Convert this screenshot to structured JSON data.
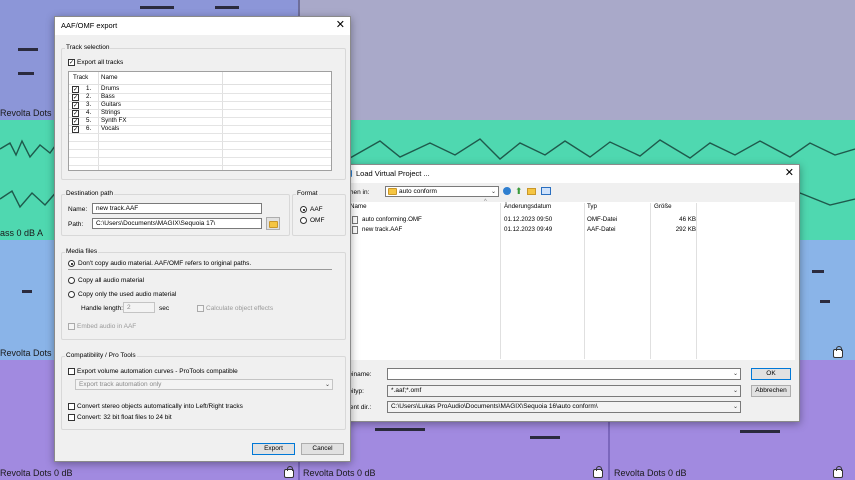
{
  "background": {
    "labels_left": [
      "Revolta Dots",
      "ass  0 dB  A",
      "Revolta Dots",
      "Revolta Dots  0 dB"
    ],
    "labels_bottom": [
      "Revolta Dots  0 dB",
      "Revolta Dots  0 dB"
    ]
  },
  "export_dialog": {
    "title": "AAF/OMF export",
    "track_selection": {
      "group_title": "Track selection",
      "export_all_label": "Export all tracks",
      "columns": [
        "Track",
        "Name"
      ],
      "tracks": [
        {
          "num": "1.",
          "name": "Drums"
        },
        {
          "num": "2.",
          "name": "Bass"
        },
        {
          "num": "3.",
          "name": "Guitars"
        },
        {
          "num": "4.",
          "name": "Strings"
        },
        {
          "num": "5.",
          "name": "Synth FX"
        },
        {
          "num": "6.",
          "name": "Vocals"
        }
      ]
    },
    "destination": {
      "group_title": "Destination path",
      "name_label": "Name:",
      "name_value": "new track.AAF",
      "path_label": "Path:",
      "path_value": "C:\\Users\\Documents\\MAGIX\\Sequoia 17\\"
    },
    "format": {
      "group_title": "Format",
      "options": [
        "AAF",
        "OMF"
      ]
    },
    "media_files": {
      "group_title": "Media files",
      "opt_dont_copy": "Don't copy audio material. AAF/OMF refers to original paths.",
      "opt_copy_all": "Copy all audio material",
      "opt_copy_used": "Copy only the used audio material",
      "handle_label": "Handle length:",
      "handle_value": "2",
      "handle_unit": "sec",
      "calc_effects": "Calculate object effects",
      "embed_audio": "Embed audio in AAF"
    },
    "compat": {
      "group_title": "Compatibility / Pro Tools",
      "export_volume": "Export volume automation curves - ProTools compatible",
      "track_automation_value": "Export track automation only",
      "convert_stereo": "Convert stereo objects automatically into Left/Right tracks",
      "convert_32bit": "Convert: 32 bit float files to 24 bit"
    },
    "export_button": "Export",
    "cancel_button": "Cancel"
  },
  "load_dialog": {
    "title": "Load Virtual Project ...",
    "search_in_label": "uchen in:",
    "search_in_value": "auto conform",
    "columns": [
      "Name",
      "Änderungsdatum",
      "Typ",
      "Größe"
    ],
    "files": [
      {
        "name": "auto conforming.OMF",
        "date": "01.12.2023 09:50",
        "type": "OMF-Datei",
        "size": "46 KB"
      },
      {
        "name": "new track.AAF",
        "date": "01.12.2023 09:49",
        "type": "AAF-Datei",
        "size": "292 KB"
      }
    ],
    "filename_label": "ateiname:",
    "filetype_label": "ateityp:",
    "filetype_value": "*.aaf;*.omf",
    "recent_label": "ecent dir.:",
    "recent_value": "C:\\Users\\Lukas ProAudio\\Documents\\MAGIX\\Sequoia 16\\auto conform\\",
    "ok_button": "OK",
    "cancel_button": "Abbrechen"
  }
}
